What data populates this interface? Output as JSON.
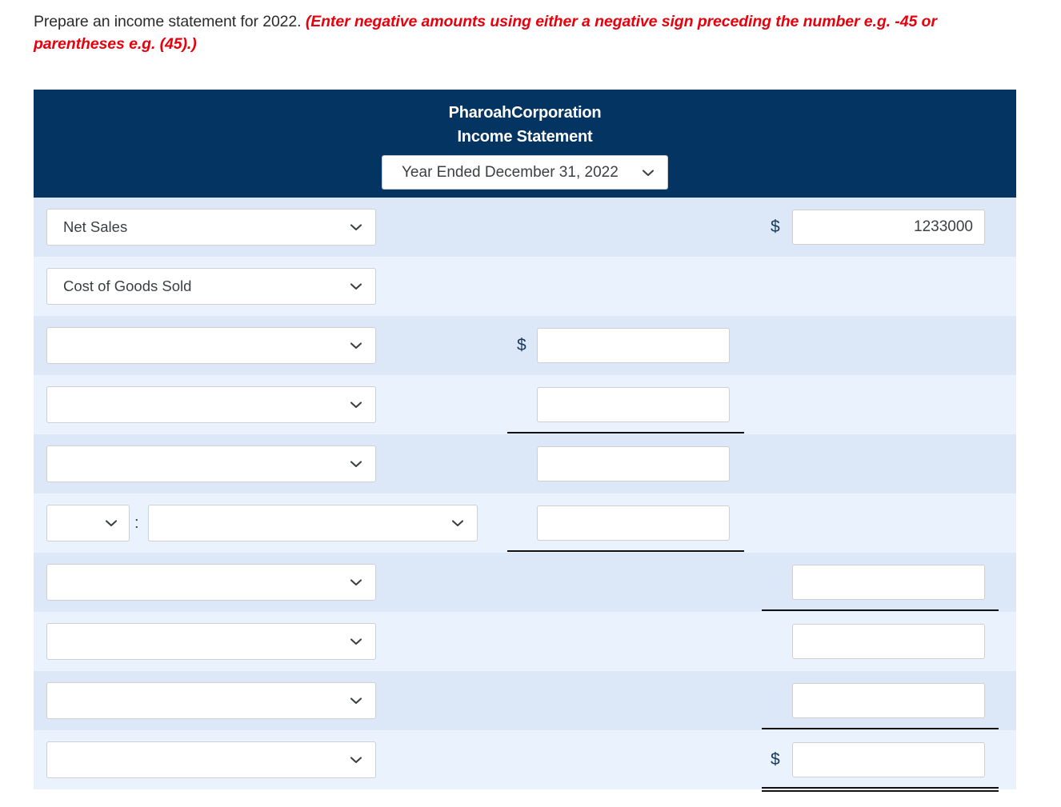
{
  "instructions": {
    "prompt": "Prepare an income statement for 2022. ",
    "hint": "(Enter negative amounts using either a negative sign preceding the number e.g. -45 or parentheses e.g. (45).)"
  },
  "statement": {
    "company_name": "PharoahCorporation",
    "statement_title": "Income Statement",
    "period_select": {
      "value": "Year Ended December 31, 2022",
      "icon": "chevron-down-icon"
    },
    "header_bg_color": "#033462",
    "row_bg_odd": "#dce8f8",
    "row_bg_even": "#eaf2fd",
    "currency_symbol": "$",
    "rows": [
      {
        "account": "Net Sales",
        "mid_dollar": "",
        "mid_value": "",
        "right_dollar": "$",
        "right_value": "1233000",
        "has_mid_input": false,
        "has_right_input": true,
        "rule": "none"
      },
      {
        "account": "Cost of Goods Sold",
        "mid_dollar": "",
        "mid_value": "",
        "right_dollar": "",
        "right_value": "",
        "has_mid_input": false,
        "has_right_input": false,
        "rule": "none"
      },
      {
        "account": "",
        "mid_dollar": "$",
        "mid_value": "",
        "right_dollar": "",
        "right_value": "",
        "has_mid_input": true,
        "has_right_input": false,
        "rule": "none"
      },
      {
        "account": "",
        "mid_dollar": "",
        "mid_value": "",
        "right_dollar": "",
        "right_value": "",
        "has_mid_input": true,
        "has_right_input": false,
        "rule": "mid"
      },
      {
        "account": "",
        "mid_dollar": "",
        "mid_value": "",
        "right_dollar": "",
        "right_value": "",
        "has_mid_input": true,
        "has_right_input": false,
        "rule": "none"
      },
      {
        "account": "",
        "split": true,
        "mini_value": "",
        "colon": ":",
        "mid_dollar": "",
        "mid_value": "",
        "right_dollar": "",
        "right_value": "",
        "has_mid_input": true,
        "has_right_input": false,
        "rule": "mid"
      },
      {
        "account": "",
        "mid_dollar": "",
        "mid_value": "",
        "right_dollar": "",
        "right_value": "",
        "has_mid_input": false,
        "has_right_input": true,
        "rule": "right"
      },
      {
        "account": "",
        "mid_dollar": "",
        "mid_value": "",
        "right_dollar": "",
        "right_value": "",
        "has_mid_input": false,
        "has_right_input": true,
        "rule": "none"
      },
      {
        "account": "",
        "mid_dollar": "",
        "mid_value": "",
        "right_dollar": "",
        "right_value": "",
        "has_mid_input": false,
        "has_right_input": true,
        "rule": "right"
      },
      {
        "account": "",
        "mid_dollar": "",
        "mid_value": "",
        "right_dollar": "$",
        "right_value": "",
        "has_mid_input": false,
        "has_right_input": true,
        "rule": "double"
      }
    ]
  }
}
